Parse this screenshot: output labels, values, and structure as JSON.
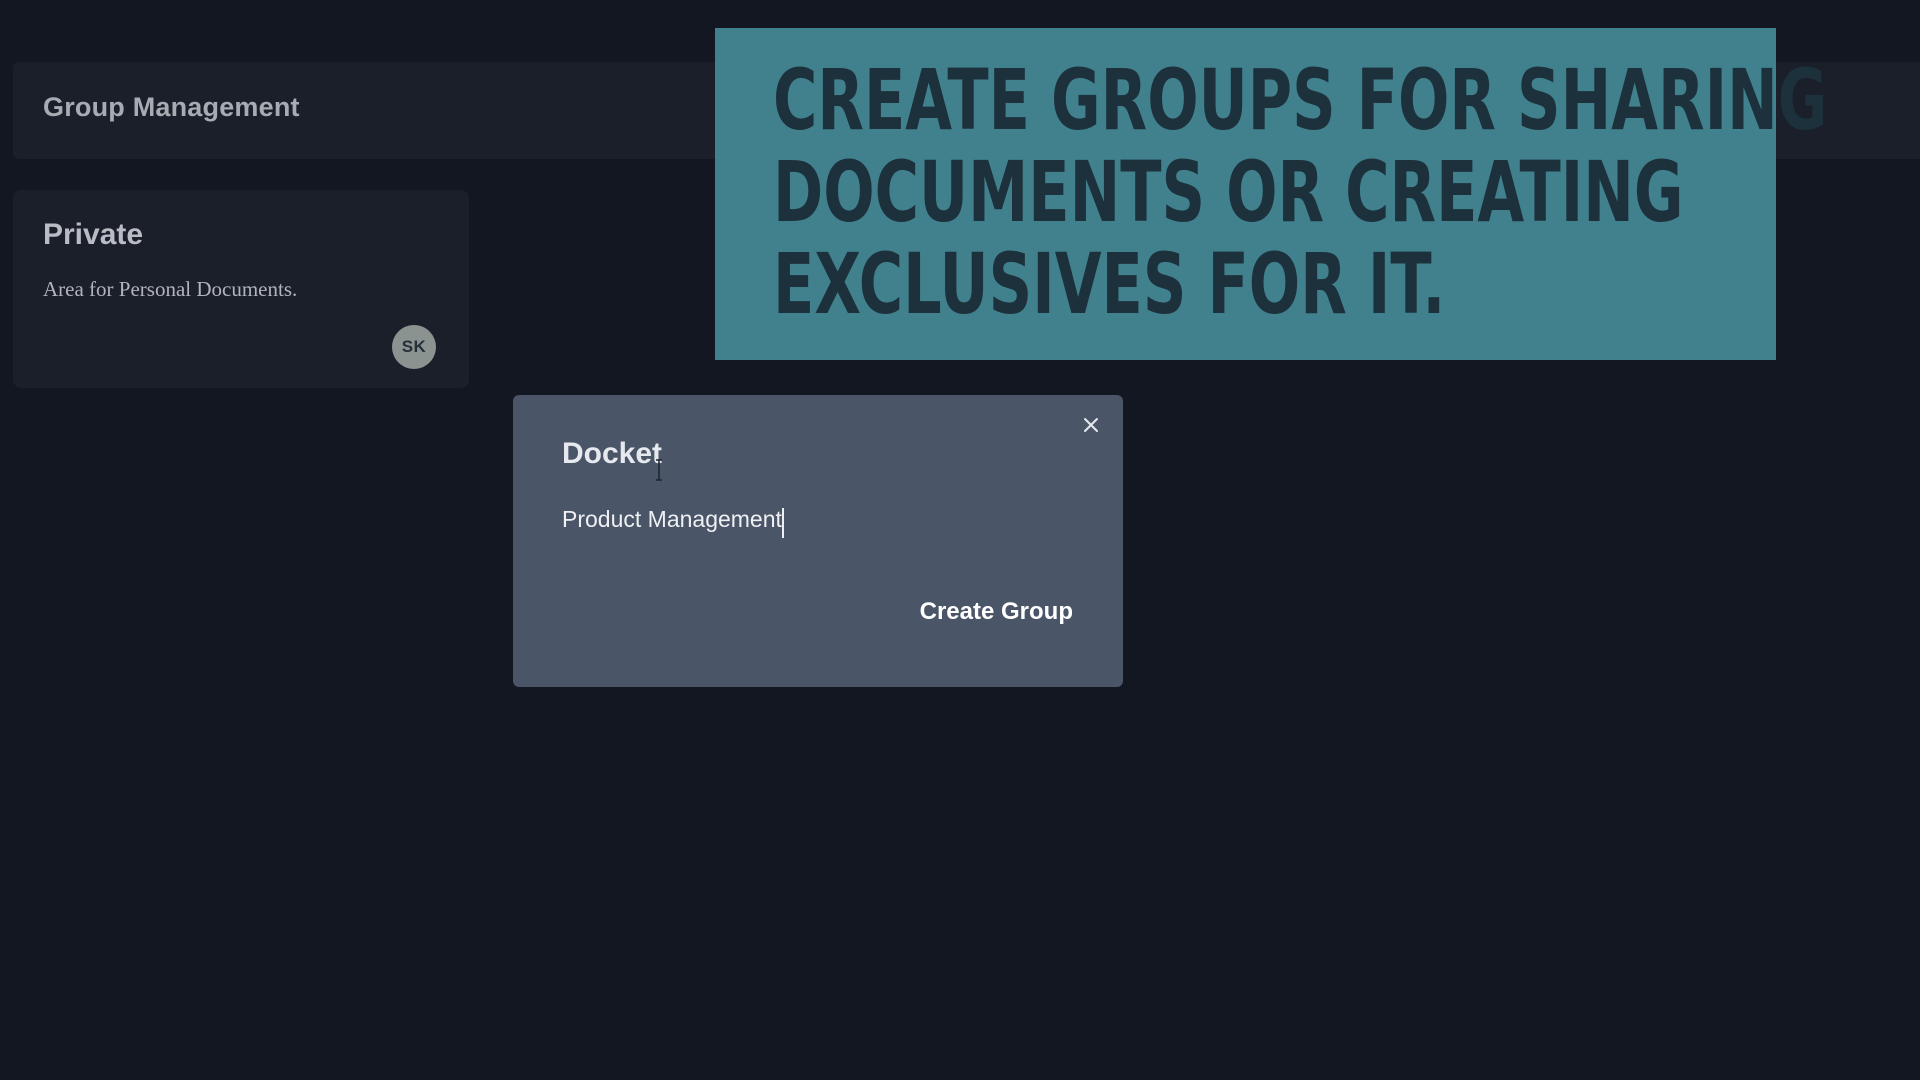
{
  "header": {
    "title": "Group Management"
  },
  "groups": [
    {
      "title": "Private",
      "description": "Area for Personal Documents.",
      "member_initials": "SK"
    }
  ],
  "banner": {
    "lines": [
      "Create groups for sharing",
      "documents or creating",
      "exclusives for it."
    ]
  },
  "modal": {
    "title": "Docket",
    "name_value": "Product Management",
    "create_label": "Create Group",
    "close_icon": "close-icon"
  },
  "colors": {
    "background": "#131722",
    "card": "#1a1f2a",
    "banner": "#41808d",
    "banner_text": "#1c313b",
    "modal": "#4a5568",
    "avatar": "#8a938f"
  }
}
